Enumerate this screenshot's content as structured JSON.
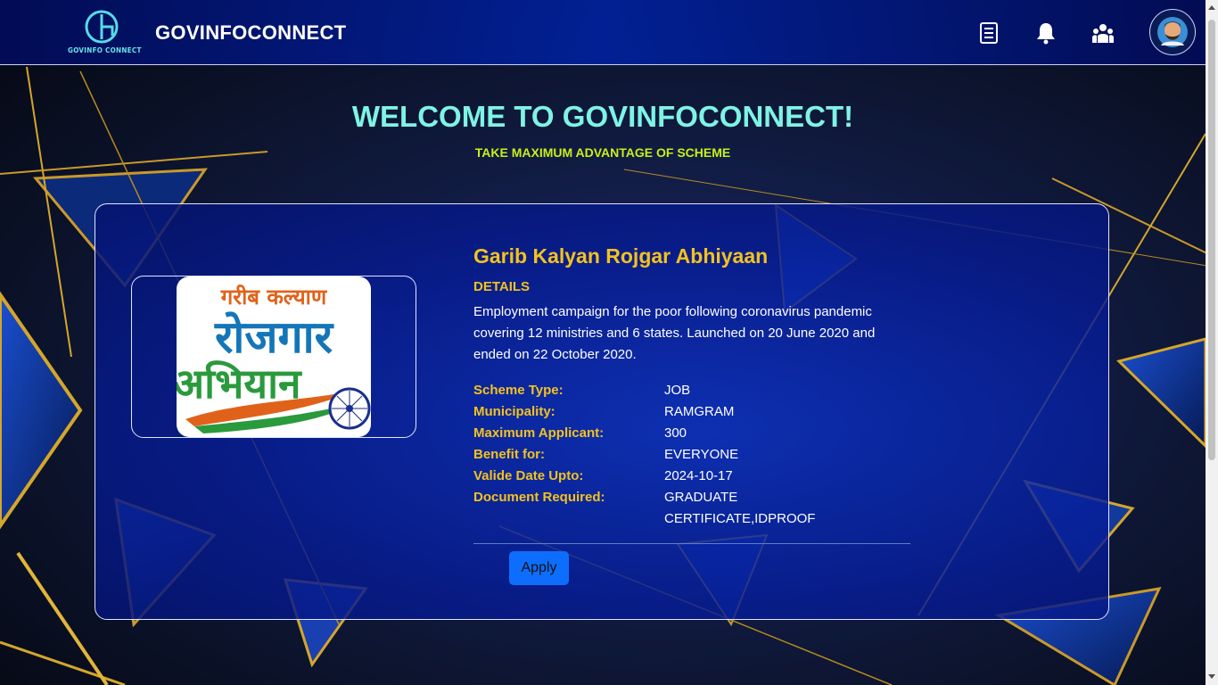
{
  "header": {
    "logo_text": "GOVINFO CONNECT",
    "brand": "GOVINFOCONNECT",
    "icons": [
      "document-icon",
      "bell-icon",
      "users-icon",
      "user-avatar"
    ]
  },
  "hero": {
    "welcome": "WELCOME TO GOVINFOCONNECT!",
    "tagline": "TAKE MAXIMUM ADVANTAGE OF SCHEME"
  },
  "scheme": {
    "image_text": {
      "line1": "गरीब कल्याण",
      "line2": "रोजगार",
      "line3": "अभियान"
    },
    "title": "Garib Kalyan Rojgar Abhiyaan",
    "details_heading": "DETAILS",
    "description": "Employment campaign for the poor following coronavirus pandemic covering 12 ministries and 6 states. Launched on 20 June 2020 and ended on 22 October 2020.",
    "fields": [
      {
        "label": "Scheme Type:",
        "value": "JOB"
      },
      {
        "label": "Municipality:",
        "value": "RAMGRAM"
      },
      {
        "label": "Maximum Applicant:",
        "value": "300"
      },
      {
        "label": "Benefit for:",
        "value": "EVERYONE"
      },
      {
        "label": "Valide Date Upto:",
        "value": "2024-10-17"
      },
      {
        "label": "Document Required:",
        "value": "GRADUATE CERTIFICATE,IDPROOF"
      }
    ],
    "apply_label": "Apply"
  },
  "colors": {
    "accent_gold": "#f3c21e",
    "welcome_teal": "#7ff3e4",
    "tagline_lime": "#c6f01a",
    "apply_blue": "#0d6efd"
  }
}
